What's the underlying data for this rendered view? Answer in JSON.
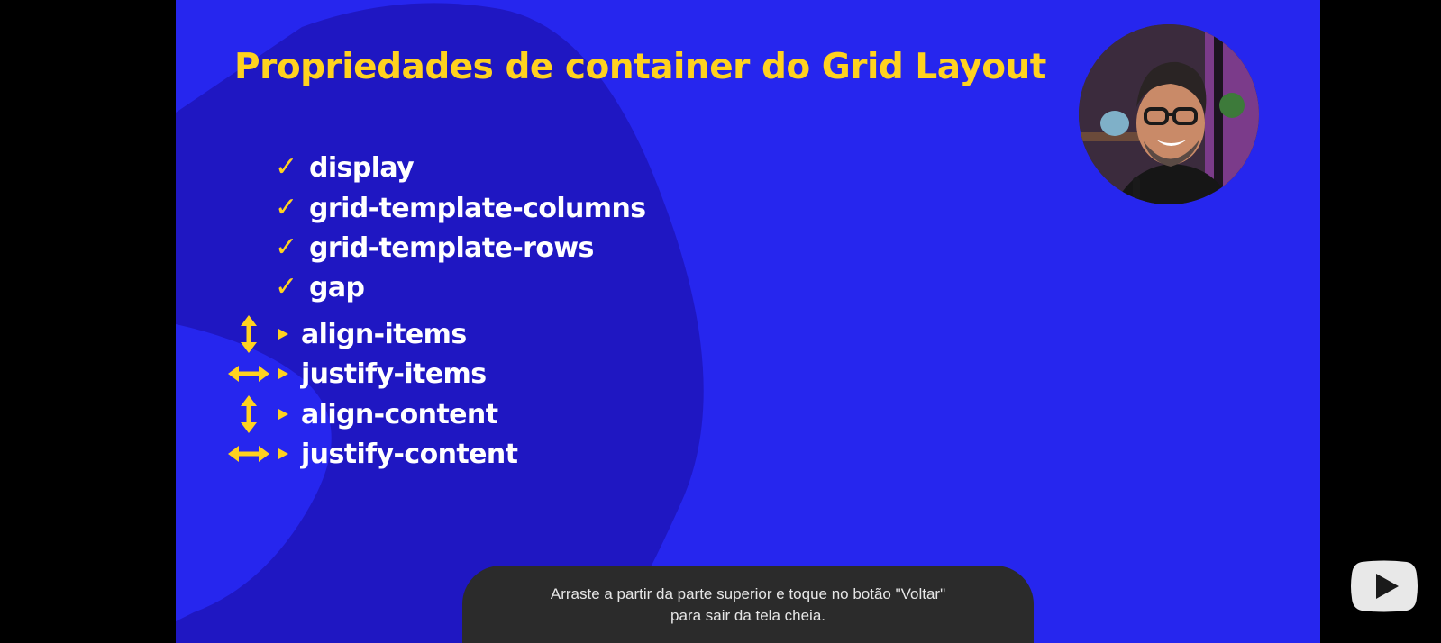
{
  "slide": {
    "title": "Propriedades de container do Grid Layout",
    "colors": {
      "background": "#2626ee",
      "blob": "#1f17c2",
      "title": "#ffd21f",
      "text": "#ffffff"
    },
    "checked_items": [
      {
        "label": "display",
        "icon": "check-icon"
      },
      {
        "label": "grid-template-columns",
        "icon": "check-icon"
      },
      {
        "label": "grid-template-rows",
        "icon": "check-icon"
      },
      {
        "label": "gap",
        "icon": "check-icon"
      }
    ],
    "pending_items": [
      {
        "label": "align-items",
        "icon": "vertical-arrows-icon"
      },
      {
        "label": "justify-items",
        "icon": "horizontal-arrows-icon"
      },
      {
        "label": "align-content",
        "icon": "vertical-arrows-icon"
      },
      {
        "label": "justify-content",
        "icon": "horizontal-arrows-icon"
      }
    ]
  },
  "presenter": {
    "icon": "presenter-webcam-avatar"
  },
  "toast": {
    "line1": "Arraste a partir da parte superior e toque no botão \"Voltar\"",
    "line2": "para sair da tela cheia."
  },
  "youtube_button": {
    "icon": "youtube-play-icon"
  }
}
